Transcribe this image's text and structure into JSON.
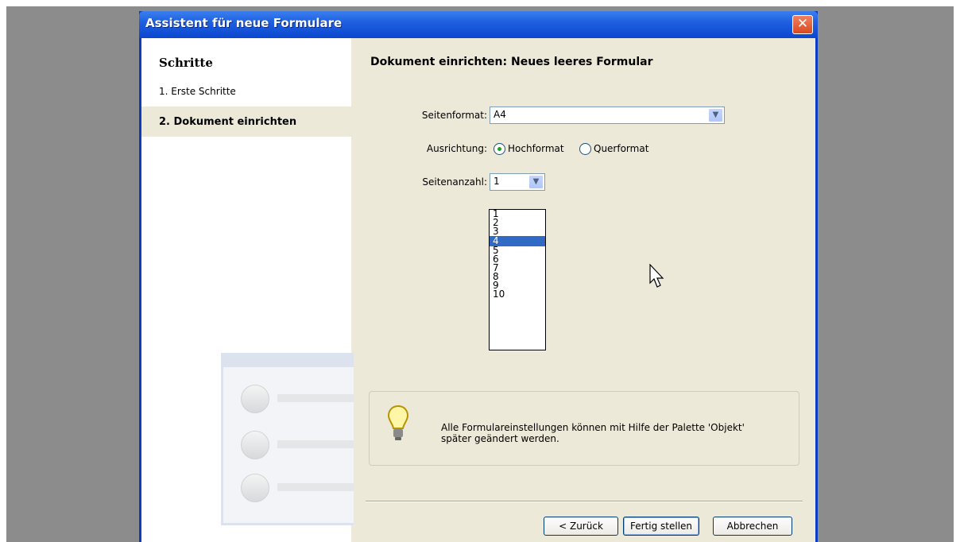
{
  "window": {
    "title": "Assistent für neue Formulare",
    "close_glyph": "✕"
  },
  "sidebar": {
    "title": "Schritte",
    "steps": [
      {
        "label": "1. Erste Schritte",
        "active": false
      },
      {
        "label": "2. Dokument einrichten",
        "active": true
      }
    ]
  },
  "main": {
    "heading": "Dokument einrichten: Neues leeres Formular",
    "page_format": {
      "label": "Seitenformat:",
      "value": "A4"
    },
    "orientation": {
      "label": "Ausrichtung:",
      "options": [
        {
          "label": "Hochformat",
          "checked": true
        },
        {
          "label": "Querformat",
          "checked": false
        }
      ]
    },
    "page_count": {
      "label": "Seitenanzahl:",
      "value": "1",
      "options": [
        "1",
        "2",
        "3",
        "4",
        "5",
        "6",
        "7",
        "8",
        "9",
        "10"
      ],
      "highlighted": "4"
    },
    "tip": {
      "icon": "lightbulb-icon",
      "line1": "Alle Formulareinstellungen können mit Hilfe der Palette 'Objekt'",
      "line2": "später geändert werden."
    }
  },
  "buttons": {
    "back": "< Zurück",
    "finish": "Fertig stellen",
    "cancel": "Abbrechen"
  },
  "colors": {
    "titlebar": "#0b47cf",
    "selection": "#316ac5",
    "dialog_bg": "#ece9d8"
  }
}
